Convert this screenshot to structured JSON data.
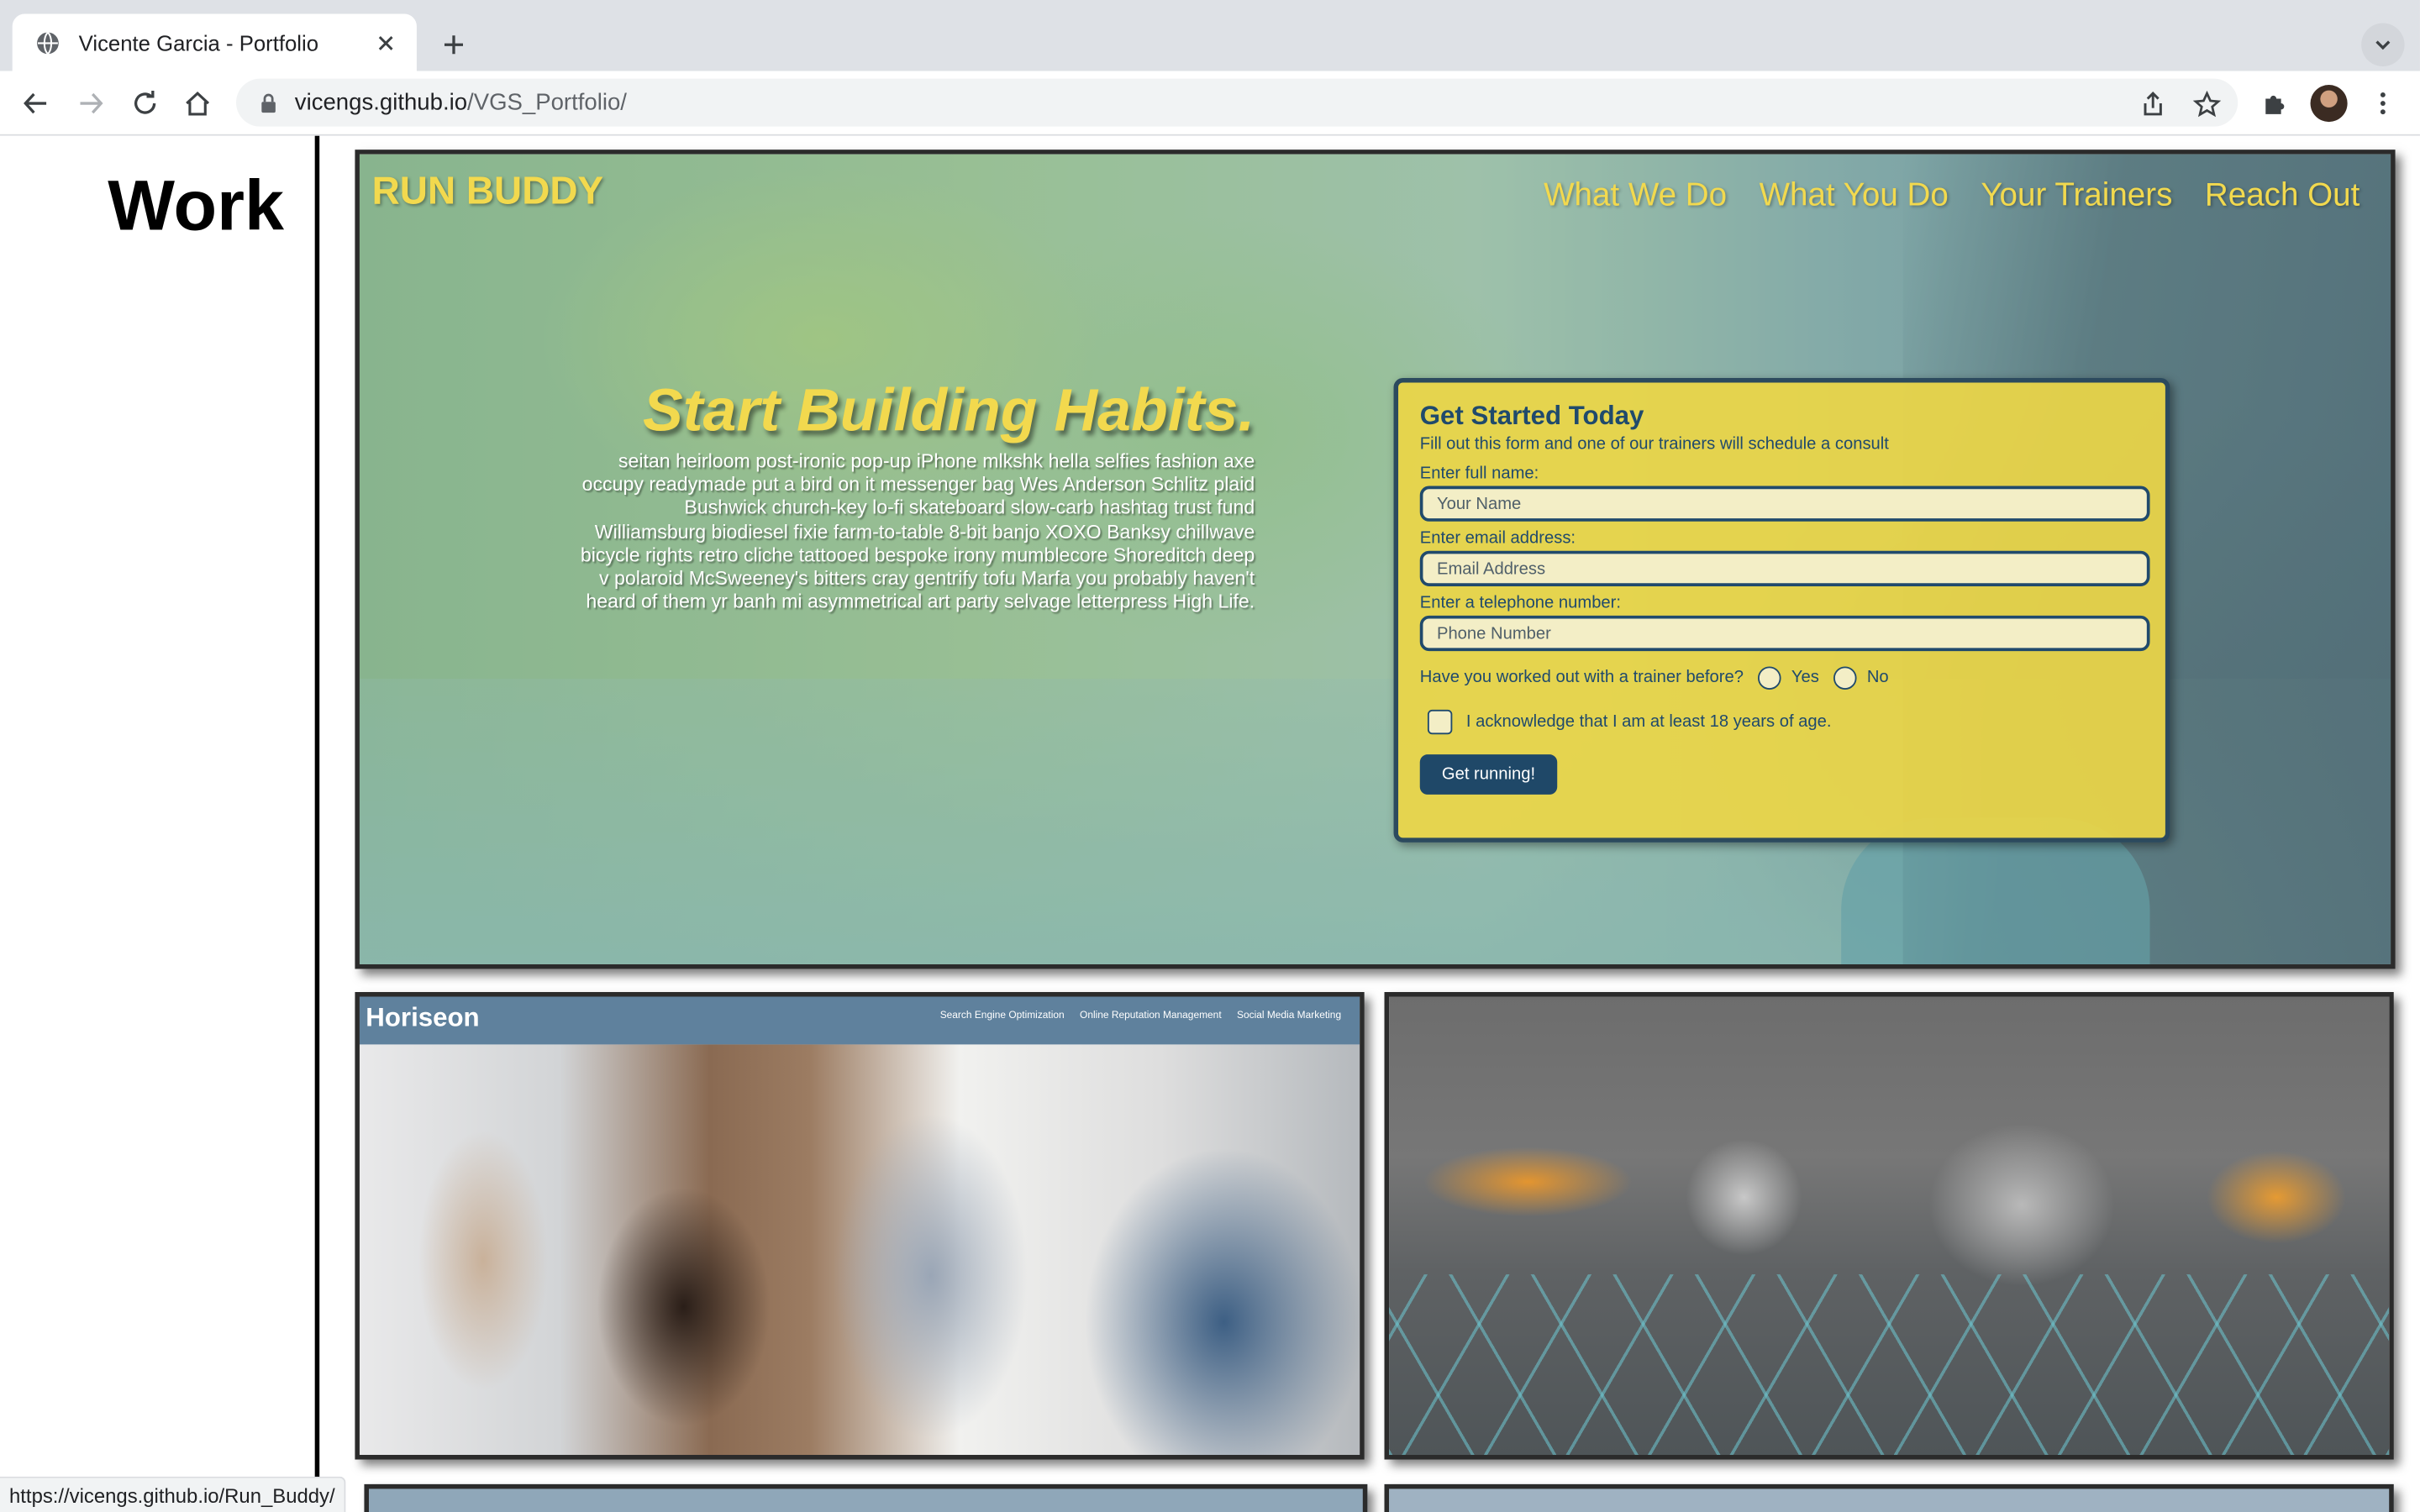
{
  "browser": {
    "tab_title": "Vicente Garcia - Portfolio",
    "url_host": "vicengs.github.io",
    "url_path": "/VGS_Portfolio/",
    "status_url": "https://vicengs.github.io/Run_Buddy/"
  },
  "page": {
    "section_title": "Work"
  },
  "run_buddy": {
    "brand": "RUN BUDDY",
    "nav": [
      "What We Do",
      "What You Do",
      "Your Trainers",
      "Reach Out"
    ],
    "headline": "Start Building Habits.",
    "body": "seitan heirloom post-ironic pop-up iPhone mlkshk hella selfies fashion axe occupy readymade put a bird on it messenger bag Wes Anderson Schlitz plaid Bushwick church-key lo-fi skateboard slow-carb hashtag trust fund Williamsburg biodiesel fixie farm-to-table 8-bit banjo XOXO Banksy chillwave bicycle rights retro cliche tattooed bespoke irony mumblecore Shoreditch deep v polaroid McSweeney's bitters cray gentrify tofu Marfa you probably haven't heard of them yr banh mi asymmetrical art party selvage letterpress High Life.",
    "form": {
      "title": "Get Started Today",
      "subtitle": "Fill out this form and one of our trainers will schedule a consult",
      "name_label": "Enter full name:",
      "name_placeholder": "Your Name",
      "email_label": "Enter email address:",
      "email_placeholder": "Email Address",
      "phone_label": "Enter a telephone number:",
      "phone_placeholder": "Phone Number",
      "trainer_question": "Have you worked out with a trainer before?",
      "yes": "Yes",
      "no": "No",
      "age_ack": "I acknowledge that I am at least 18 years of age.",
      "submit": "Get running!"
    }
  },
  "horiseon": {
    "logo": "Horiseon",
    "nav": [
      "Search Engine Optimization",
      "Online Reputation Management",
      "Social Media Marketing"
    ]
  },
  "colors": {
    "run_buddy_yellow": "#f2d94e",
    "run_buddy_navy": "#204a6c",
    "horiseon_header": "#5f819d"
  }
}
